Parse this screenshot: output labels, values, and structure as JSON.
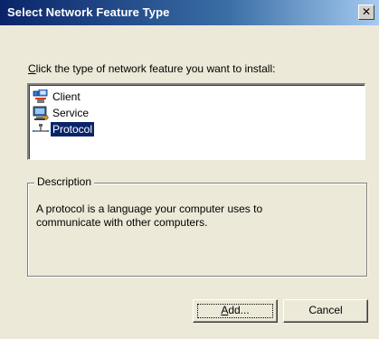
{
  "window": {
    "title": "Select Network Feature Type",
    "close_glyph": "✕"
  },
  "prompt": {
    "accel": "C",
    "rest": "lick the type of network feature you want to install:"
  },
  "feature_list": {
    "items": [
      {
        "label": "Client",
        "icon": "client-icon",
        "selected": false
      },
      {
        "label": "Service",
        "icon": "service-icon",
        "selected": false
      },
      {
        "label": "Protocol",
        "icon": "protocol-icon",
        "selected": true
      }
    ]
  },
  "description": {
    "legend": "Description",
    "text": "A protocol is a language your computer uses to communicate with other computers."
  },
  "buttons": {
    "add_accel": "A",
    "add_rest": "dd...",
    "cancel": "Cancel"
  },
  "colors": {
    "titlebar_start": "#0a246a",
    "selection": "#0a246a",
    "dialog_bg": "#ece9d8"
  }
}
